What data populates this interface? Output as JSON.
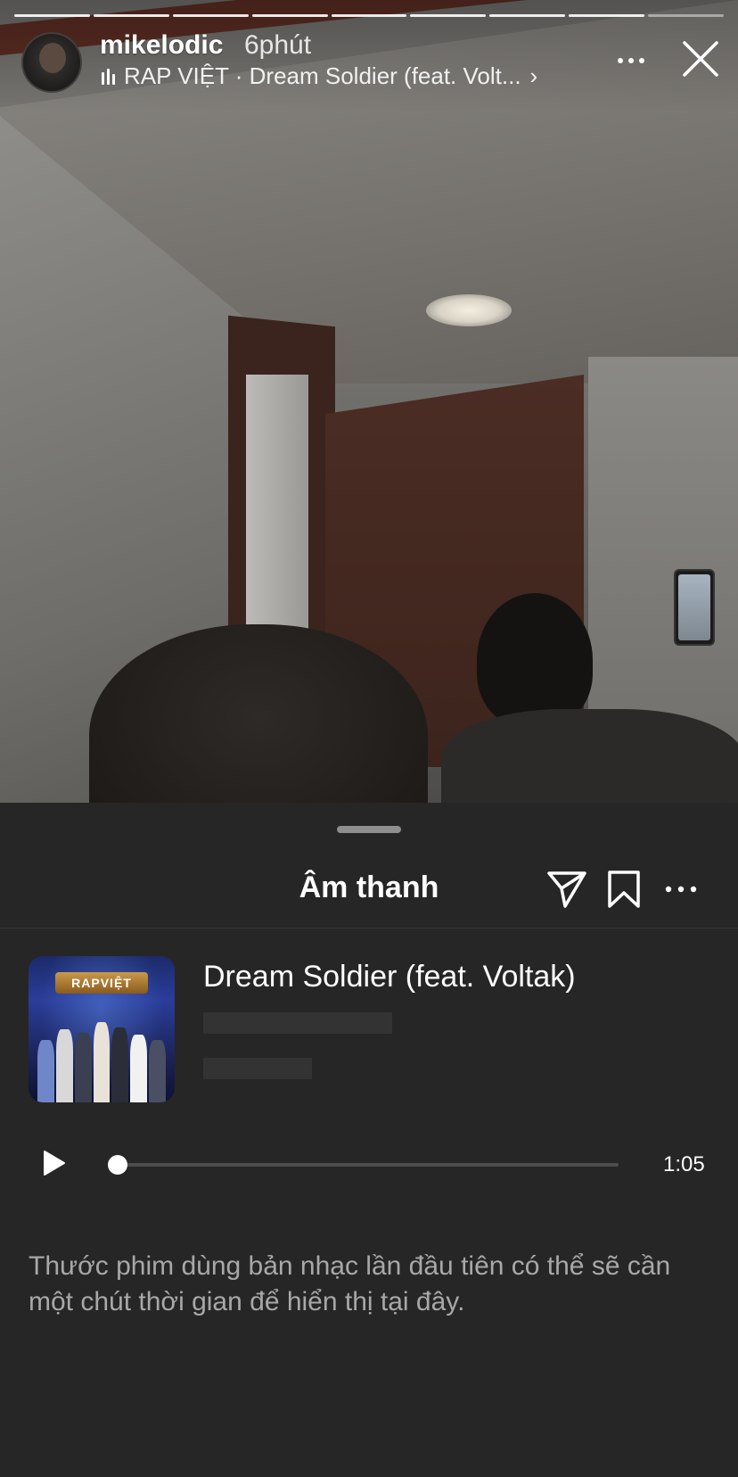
{
  "story": {
    "progress_segments": 9,
    "progress_done": 8,
    "username": "mikelodic",
    "time_ago": "6phút",
    "music_label": "RAP VIỆT · Dream Soldier (feat. Volt...",
    "music_chevron": "›",
    "more_icon": "more-horizontal-icon",
    "close_icon": "close-icon"
  },
  "sheet": {
    "title": "Âm thanh",
    "icons": [
      "send-icon",
      "bookmark-icon",
      "more-horizontal-icon"
    ]
  },
  "track": {
    "title": "Dream Soldier (feat. Voltak)",
    "album_logo": "RAPVIỆT",
    "duration": "1:05",
    "progress": 0.0,
    "play_icon": "play-icon"
  },
  "notice": "Thước phim dùng bản nhạc lần đầu tiên có thể sẽ cần một chút thời gian để hiển thị tại đây.",
  "colors": {
    "sheet_bg": "#262626",
    "placeholder": "#333333",
    "muted_text": "#a8a8a8",
    "divider": "#383838"
  }
}
